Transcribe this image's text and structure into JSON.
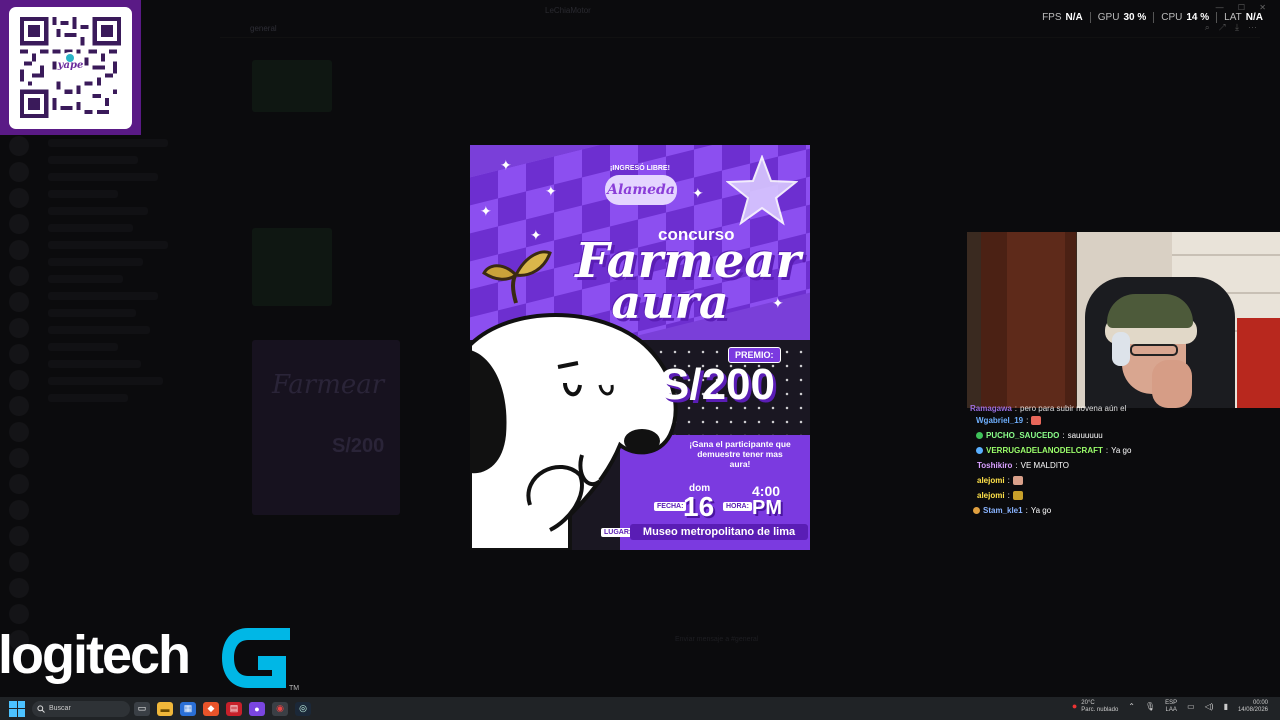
{
  "window": {
    "title": "LeChiaMotor"
  },
  "background_app": {
    "channel_header": "general",
    "input_placeholder": "Enviar mensaje a #general"
  },
  "qr": {
    "brand": "yape"
  },
  "stats": [
    {
      "label": "FPS",
      "value": "N/A"
    },
    {
      "label": "GPU",
      "value": "30 %"
    },
    {
      "label": "CPU",
      "value": "14 %"
    },
    {
      "label": "LAT",
      "value": "N/A"
    }
  ],
  "poster": {
    "ingreso": "¡INGRESÓ LIBRE!",
    "venue_logo": "Alameda",
    "concurso": "concurso",
    "title_line1": "Farmear",
    "title_line2": "aura",
    "premio_label": "PREMIO:",
    "amount": "S/200",
    "gana_text": "¡Gana el participante que demuestre tener mas aura!",
    "fecha_label": "FECHA:",
    "day_name": "dom",
    "day_number": "16",
    "hora_label": "HORA:",
    "time_num": "4:00",
    "time_ampm": "PM",
    "lugar_label": "LUGAR:",
    "lugar": "Museo metropolitano de lima"
  },
  "chat": [
    {
      "user": "Ramagawa",
      "message": "pero para subir novena aún el",
      "color": "#b07cff",
      "emote": "",
      "cut": true
    },
    {
      "user": "Wgabriel_19",
      "message": "",
      "color": "#6fb0ff",
      "emote": "#e8675a",
      "cut": false
    },
    {
      "user": "PUCHO_SAUCEDO",
      "message": "sauuuuuu",
      "color": "#8bff8b",
      "emote": "",
      "badge": "#3fc25a",
      "cut": false
    },
    {
      "user": "VERRUGADELANODELCRAFT",
      "message": "Ya go",
      "color": "#9bff6b",
      "emote": "",
      "badge": "#5ab0ff",
      "cut": false
    },
    {
      "user": "Toshikiro",
      "message": "VE MALDITO",
      "color": "#d9a0ff",
      "emote": "",
      "cut": false
    },
    {
      "user": "alejomi",
      "message": "",
      "color": "#ffe24a",
      "emote": "#d9a08a",
      "cut": false
    },
    {
      "user": "alejomi",
      "message": "",
      "color": "#ffe24a",
      "emote": "#c8a02a",
      "cut": false
    },
    {
      "user": "Stam_kle1",
      "message": "Ya go",
      "color": "#8ab4ff",
      "emote": "",
      "badge": "#e0a040",
      "cut": false
    }
  ],
  "sponsor": {
    "word": "logitech",
    "mark": "G",
    "tm": "TM"
  },
  "taskbar": {
    "search_placeholder": "Buscar",
    "apps": [
      "file-explorer",
      "browser-brave",
      "app-red",
      "app-purple",
      "app-steam",
      "app-discord",
      "app-blue"
    ],
    "weather_temp": "20°C",
    "weather_desc": "Parc. nublado",
    "lang1": "ESP",
    "lang2": "LAA",
    "time": "00:00",
    "date": "14/08/2026"
  },
  "colors": {
    "accent_purple": "#7b3ae0",
    "qr_bg": "#5a1a86",
    "taskbar": "#202326"
  }
}
